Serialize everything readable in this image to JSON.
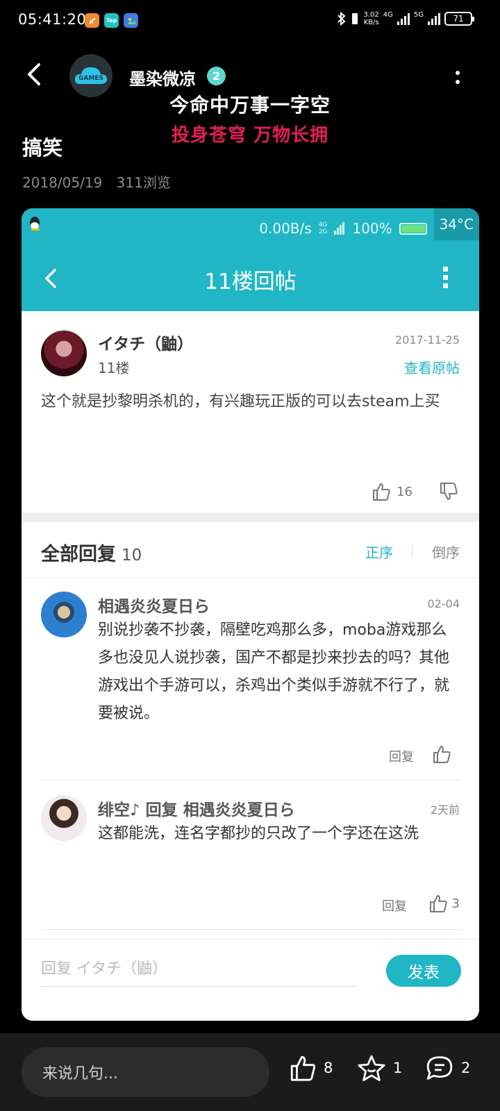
{
  "status_bar": {
    "time": "05:41:20",
    "apps": [
      {
        "name": "app-icon-1",
        "label": "",
        "color": "#f08a2c"
      },
      {
        "name": "app-icon-tap",
        "label": "Tap",
        "color": "#20c4c4"
      },
      {
        "name": "app-icon-3",
        "label": "",
        "color": "#3f7de0"
      }
    ],
    "net_speed_value": "3.02",
    "net_speed_unit": "KB/s",
    "sig1_label": "4G",
    "sig2_label": "5G",
    "battery": "71"
  },
  "header": {
    "avatar_text": "GAMES",
    "username": "墨染微凉",
    "badge_level": "2",
    "signature_line1": "今命中万事一字空",
    "signature_line2": "投身苍穹 万物长拥"
  },
  "post": {
    "title": "搞笑",
    "date": "2018/05/19",
    "views": "311浏览"
  },
  "screenshot": {
    "status": {
      "speed": "0.00B/s",
      "net_top": "4G",
      "net_bottom": "2G",
      "battery": "100%",
      "temp": "34°C"
    },
    "nav_title": "11楼回帖",
    "floor": {
      "user": "イタチ（鼬）",
      "floor_num": "11楼",
      "date": "2017-11-25",
      "view_original": "查看原帖",
      "text": "这个就是抄黎明杀机的，有兴趣玩正版的可以去steam上买",
      "likes": "16"
    },
    "replies_label": "全部回复",
    "replies_count": "10",
    "sort_asc": "正序",
    "sort_desc": "倒序",
    "replies": [
      {
        "user": "相遇炎炎夏日ら",
        "date": "02-04",
        "text": "别说抄袭不抄袭，隔壁吃鸡那么多，moba游戏那么多也没见人说抄袭，国产不都是抄来抄去的吗？其他游戏出个手游可以，杀鸡出个类似手游就不行了，就要被说。",
        "reply_label": "回复",
        "likes": ""
      },
      {
        "user": "绯空♪ 回复 相遇炎炎夏日ら",
        "date": "2天前",
        "text": "这都能洗，连名字都抄的只改了一个字还在这洗",
        "reply_label": "回复",
        "likes": "3"
      }
    ],
    "reply_placeholder": "回复 イタチ（鼬）",
    "publish_label": "发表"
  },
  "bottom_bar": {
    "comment_placeholder": "来说几句...",
    "likes": "8",
    "favorites": "1",
    "comments": "2"
  }
}
